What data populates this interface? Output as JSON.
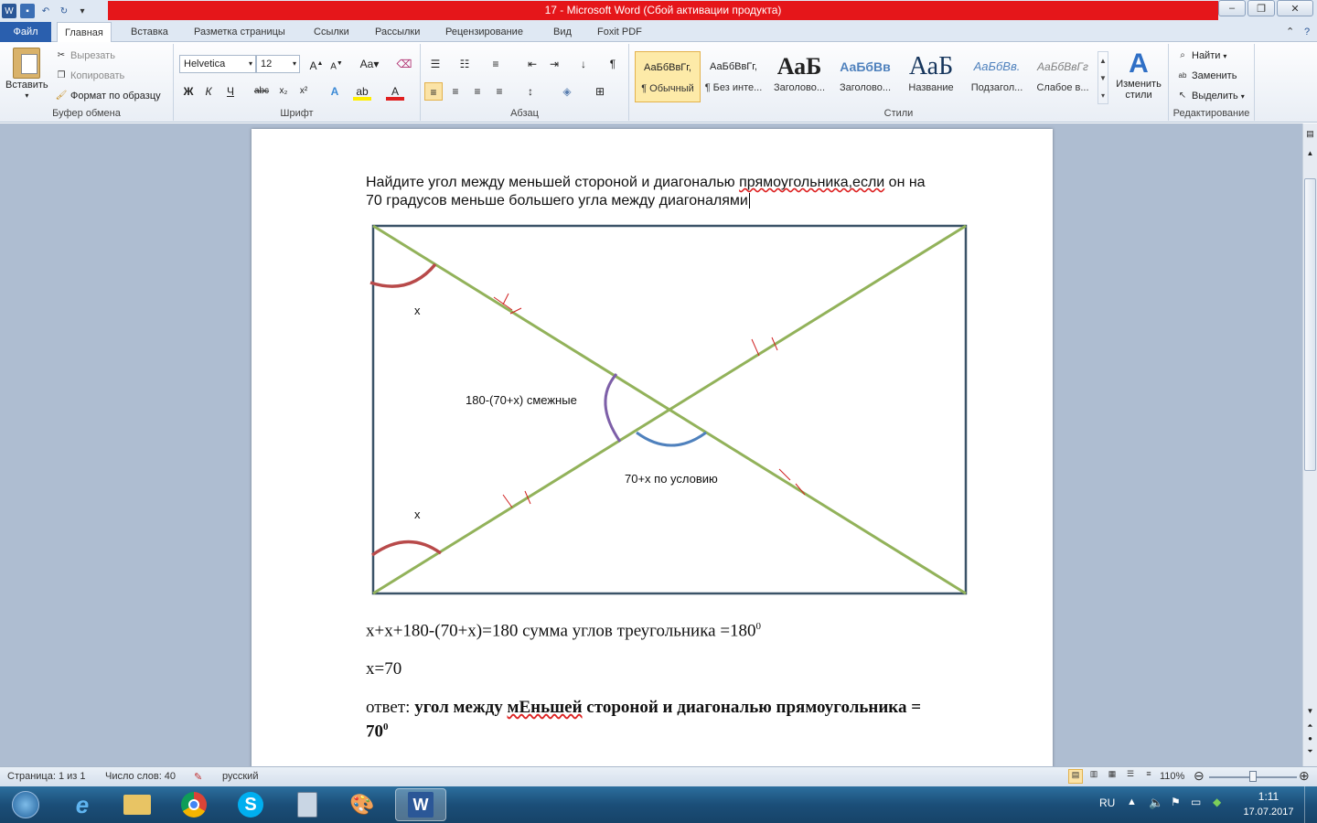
{
  "window": {
    "title": "17  -  Microsoft Word (Сбой активации продукта)"
  },
  "ribbon_tabs": [
    "Файл",
    "Главная",
    "Вставка",
    "Разметка страницы",
    "Ссылки",
    "Рассылки",
    "Рецензирование",
    "Вид",
    "Foxit PDF"
  ],
  "clipboard": {
    "paste": "Вставить",
    "cut": "Вырезать",
    "copy": "Копировать",
    "format_painter": "Формат по образцу",
    "label": "Буфер обмена"
  },
  "font": {
    "name": "Helvetica",
    "size": "12",
    "label": "Шрифт"
  },
  "paragraph": {
    "label": "Абзац"
  },
  "styles": {
    "items": [
      {
        "preview": "АаБбВвГг,",
        "caption": "¶ Обычный"
      },
      {
        "preview": "АаБбВвГг,",
        "caption": "¶ Без инте..."
      },
      {
        "preview": "АаБ",
        "caption": "Заголово..."
      },
      {
        "preview": "АаБбВв",
        "caption": "Заголово..."
      },
      {
        "preview": "АаБ",
        "caption": "Название"
      },
      {
        "preview": "АаБбВв.",
        "caption": "Подзагол..."
      },
      {
        "preview": "АаБбВвГг",
        "caption": "Слабое в..."
      }
    ],
    "change": "Изменить стили",
    "label": "Стили"
  },
  "editing": {
    "find": "Найти",
    "replace": "Заменить",
    "select": "Выделить",
    "label": "Редактирование"
  },
  "document": {
    "question_line1_a": "Найдите угол между меньшей стороной и диагональю ",
    "question_line1_b": "прямоугольника,если",
    "question_line1_c": " он на",
    "question_line2": "70 градусов меньше большего угла между диагоналями",
    "label_x_top": "x",
    "label_x_bottom": "x",
    "label_adjacent": "180-(70+x) смежные",
    "label_condition": "70+x по условию",
    "eq1": "x+x+180-(70+x)=180 сумма углов треугольника =180",
    "eq1_sup": "0",
    "eq2": "x=70",
    "answer_prefix": "ответ: ",
    "answer_bold_a": "угол между ",
    "answer_bold_b": "мЕньшей",
    "answer_bold_c": " стороной и диагональю прямоугольника =",
    "answer_line2": "70",
    "answer_sup": "0"
  },
  "status": {
    "page": "Страница: 1 из 1",
    "words": "Число слов: 40",
    "lang": "русский",
    "zoom": "110%"
  },
  "taskbar": {
    "lang": "RU",
    "time": "1:11",
    "date": "17.07.2017"
  }
}
